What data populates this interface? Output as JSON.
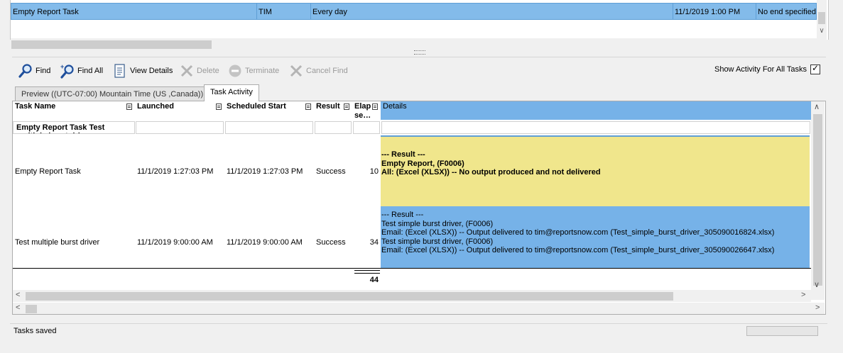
{
  "top_grid": {
    "row": {
      "name": "Empty Report Task",
      "owner": "TIM",
      "schedule": "Every day",
      "start": "11/1/2019 1:00 PM",
      "end": "No end specified"
    }
  },
  "toolbar": {
    "find": "Find",
    "find_all": "Find All",
    "view_details": "View Details",
    "delete": "Delete",
    "terminate": "Terminate",
    "cancel_find": "Cancel Find",
    "show_activity_label": "Show Activity For All Tasks",
    "show_activity_checked": true
  },
  "tabs": {
    "preview": "Preview ((UTC-07:00) Mountain Time (US ,Canada))",
    "activity": "Task Activity"
  },
  "grid": {
    "headers": {
      "task_name": "Task Name",
      "launched": "Launched",
      "scheduled_start": "Scheduled Start",
      "result": "Result",
      "elapsed": "Elap se…",
      "details": "Details"
    },
    "group_label": "Empty Report Task Test multiple burst driver",
    "rows": [
      {
        "task": "Empty Report Task",
        "launched": "11/1/2019 1:27:03 PM",
        "scheduled": "11/1/2019 1:27:03 PM",
        "result": "Success",
        "elapsed": "10",
        "details": [
          "--- Result ---",
          "Empty Report, (F0006)",
          "All: (Excel (XLSX)) -- No output produced and not delivered"
        ]
      },
      {
        "task": "Test multiple burst driver",
        "launched": "11/1/2019 9:00:00 AM",
        "scheduled": "11/1/2019 9:00:00 AM",
        "result": "Success",
        "elapsed": "34",
        "details": [
          "--- Result ---",
          "Test simple burst driver, (F0006)",
          "Email: (Excel (XLSX)) -- Output delivered to tim@reportsnow.com (Test_simple_burst_driver_305090016824.xlsx)",
          "Test simple burst driver, (F0006)",
          "Email: (Excel (XLSX)) -- Output delivered to tim@reportsnow.com (Test_simple_burst_driver_305090026647.xlsx)"
        ]
      }
    ],
    "total_elapsed": "44"
  },
  "status": {
    "text": "Tasks saved"
  },
  "colors": {
    "selection_blue": "#83bbea",
    "details_yellow": "#f0e68c",
    "details_blue": "#76b2e8"
  }
}
